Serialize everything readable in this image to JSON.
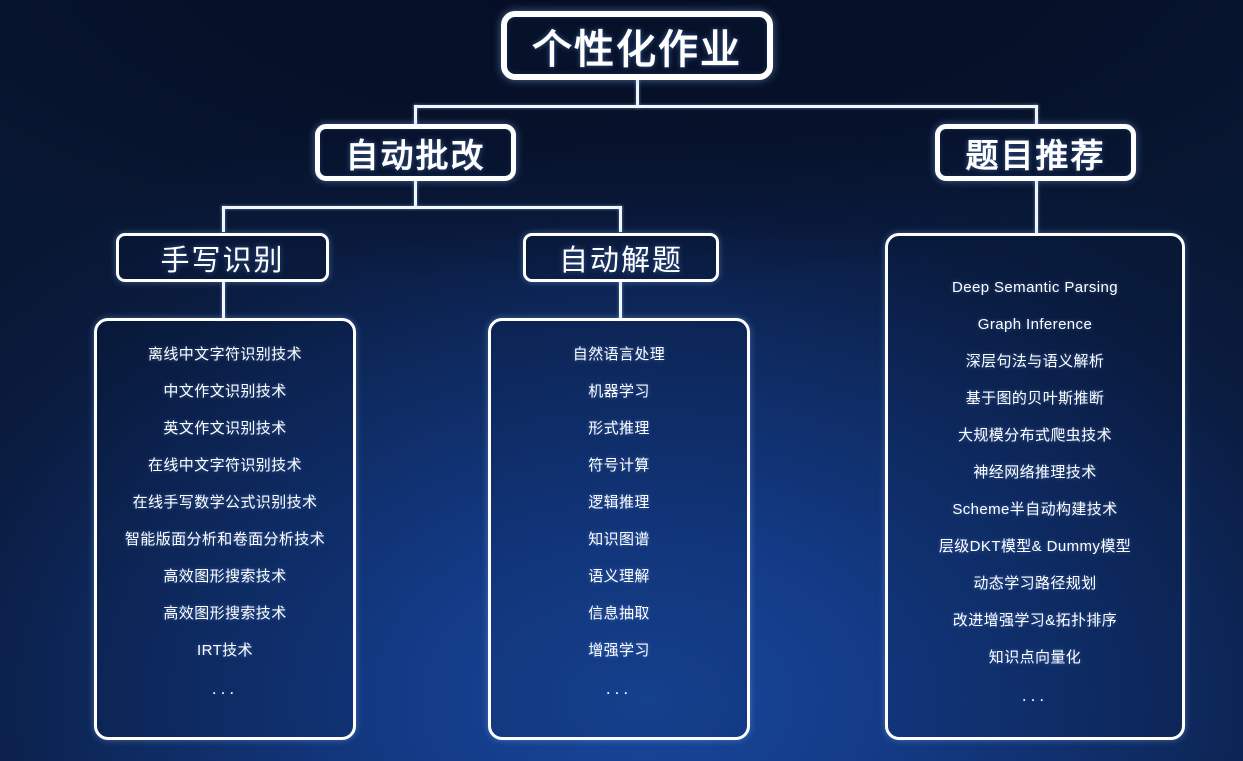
{
  "diagram": {
    "title": "个性化作业",
    "root": {
      "label": "个性化作业"
    },
    "level2": [
      {
        "label": "自动批改"
      },
      {
        "label": "题目推荐"
      }
    ],
    "level3": [
      {
        "label": "手写识别"
      },
      {
        "label": "自动解题"
      }
    ],
    "panels": [
      {
        "parent": "手写识别",
        "items": [
          "离线中文字符识别技术",
          "中文作文识别技术",
          "英文作文识别技术",
          "在线中文字符识别技术",
          "在线手写数学公式识别技术",
          "智能版面分析和卷面分析技术",
          "高效图形搜索技术",
          "高效图形搜索技术",
          "IRT技术",
          "..."
        ]
      },
      {
        "parent": "自动解题",
        "items": [
          "自然语言处理",
          "机器学习",
          "形式推理",
          "符号计算",
          "逻辑推理",
          "知识图谱",
          "语义理解",
          "信息抽取",
          "增强学习",
          "..."
        ]
      },
      {
        "parent": "题目推荐",
        "items": [
          "Deep Semantic Parsing",
          "Graph Inference",
          "深层句法与语义解析",
          "基于图的贝叶斯推断",
          "大规模分布式爬虫技术",
          "神经网络推理技术",
          "Scheme半自动构建技术",
          "层级DKT模型& Dummy模型",
          "动态学习路径规划",
          "改进增强学习&拓扑排序",
          "知识点向量化",
          "..."
        ]
      }
    ],
    "colors": {
      "background_dark": "#081733",
      "background_light": "#18479c",
      "line": "#f2f6ff",
      "text": "#ffffff"
    }
  }
}
